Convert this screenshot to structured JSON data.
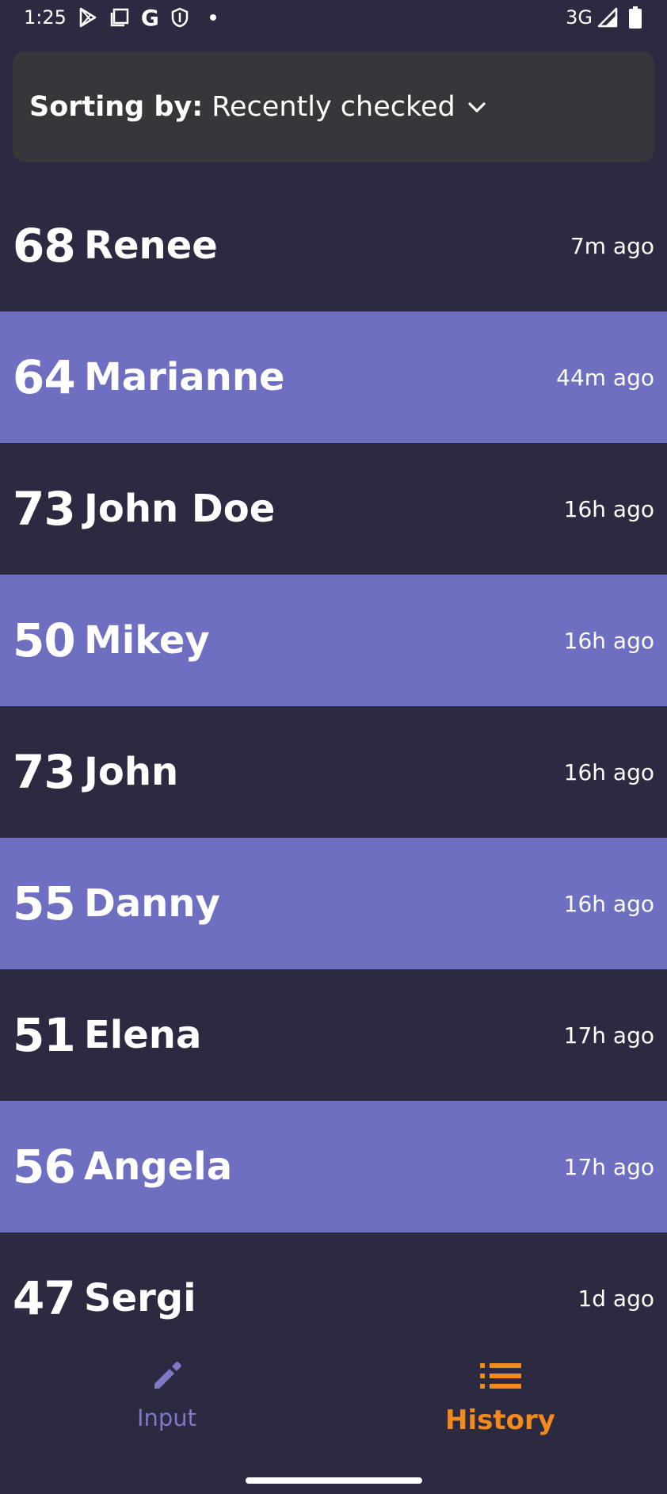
{
  "status_bar": {
    "time": "1:25",
    "network": "3G",
    "icons": [
      "play-store-icon",
      "screenshot-icon",
      "google-icon",
      "shield-icon",
      "notification-dot-icon",
      "signal-icon",
      "battery-icon"
    ],
    "google_glyph": "G"
  },
  "sort": {
    "prefix": "Sorting by:",
    "value": "Recently checked"
  },
  "history": [
    {
      "score": "68",
      "name": "Renee",
      "time": "7m ago"
    },
    {
      "score": "64",
      "name": "Marianne",
      "time": "44m ago"
    },
    {
      "score": "73",
      "name": "John Doe",
      "time": "16h ago"
    },
    {
      "score": "50",
      "name": "Mikey",
      "time": "16h ago"
    },
    {
      "score": "73",
      "name": "John",
      "time": "16h ago"
    },
    {
      "score": "55",
      "name": "Danny",
      "time": "16h ago"
    },
    {
      "score": "51",
      "name": "Elena",
      "time": "17h ago"
    },
    {
      "score": "56",
      "name": "Angela",
      "time": "17h ago"
    },
    {
      "score": "47",
      "name": "Sergi",
      "time": "1d ago"
    }
  ],
  "nav": {
    "input_label": "Input",
    "history_label": "History",
    "active": "history"
  },
  "colors": {
    "background": "#2b2a41",
    "row_highlight": "#6e6fc1",
    "card": "#38363b",
    "accent_active": "#f38b1c",
    "accent_inactive": "#7e78c7"
  }
}
